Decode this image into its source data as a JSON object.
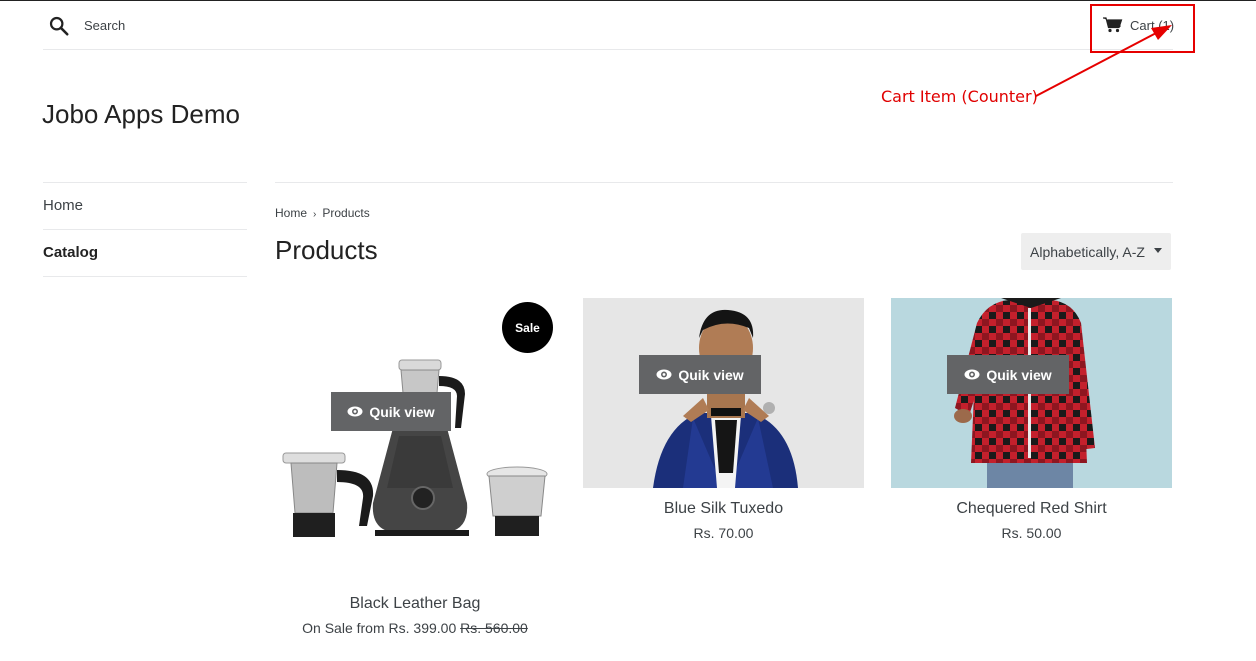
{
  "header": {
    "search_label": "Search",
    "cart_label": "Cart",
    "cart_count": "(1)"
  },
  "annotation": {
    "label": "Cart Item (Counter)",
    "color": "#e00000"
  },
  "shop": {
    "title": "Jobo Apps Demo"
  },
  "sidebar": {
    "items": [
      {
        "label": "Home"
      },
      {
        "label": "Catalog"
      }
    ]
  },
  "breadcrumb": {
    "home": "Home",
    "separator": "›",
    "current": "Products"
  },
  "page": {
    "title": "Products"
  },
  "sort": {
    "selected": "Alphabetically, A-Z"
  },
  "products": [
    {
      "name": "Black Leather Bag",
      "price_prefix": "On Sale from",
      "price": "Rs. 399.00",
      "compare_price": "Rs. 560.00",
      "badge": "Sale",
      "quick_view": "Quik view"
    },
    {
      "name": "Blue Silk Tuxedo",
      "price": "Rs. 70.00",
      "quick_view": "Quik view"
    },
    {
      "name": "Chequered Red Shirt",
      "price": "Rs. 50.00",
      "quick_view": "Quik view"
    }
  ],
  "icons": {
    "search": "search-icon",
    "cart": "cart-icon",
    "eye": "eye-icon"
  }
}
